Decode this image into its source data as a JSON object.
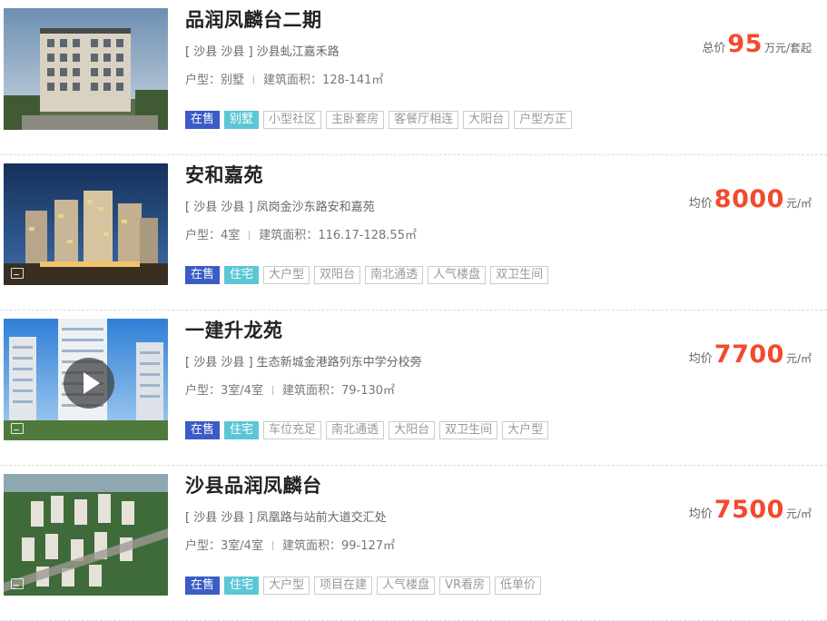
{
  "listings": [
    {
      "name": "品润凤麟台二期",
      "address": "[ 沙县 沙县 ] 沙县虬江嘉禾路",
      "layout_label": "户型：",
      "layout_value": "别墅",
      "area_label": "建筑面积：",
      "area_value": "128-141㎡",
      "status": "在售",
      "property_type": "别墅",
      "tags": [
        "小型社区",
        "主卧套房",
        "客餐厅相连",
        "大阳台",
        "户型方正"
      ],
      "price_prefix": "总价",
      "price_value": "95",
      "price_unit": "万元/套起",
      "media_icon": "none"
    },
    {
      "name": "安和嘉苑",
      "address": "[ 沙县 沙县 ] 凤岗金沙东路安和嘉苑",
      "layout_label": "户型：",
      "layout_value": "4室",
      "area_label": "建筑面积：",
      "area_value": "116.17-128.55㎡",
      "status": "在售",
      "property_type": "住宅",
      "tags": [
        "大户型",
        "双阳台",
        "南北通透",
        "人气楼盘",
        "双卫生间"
      ],
      "price_prefix": "均价",
      "price_value": "8000",
      "price_unit": "元/㎡",
      "media_icon": "picture-icon"
    },
    {
      "name": "一建升龙苑",
      "address": "[ 沙县 沙县 ] 生态新城金港路列东中学分校旁",
      "layout_label": "户型：",
      "layout_value": "3室/4室",
      "area_label": "建筑面积：",
      "area_value": "79-130㎡",
      "status": "在售",
      "property_type": "住宅",
      "tags": [
        "车位充足",
        "南北通透",
        "大阳台",
        "双卫生间",
        "大户型"
      ],
      "price_prefix": "均价",
      "price_value": "7700",
      "price_unit": "元/㎡",
      "media_icon": "play-icon"
    },
    {
      "name": "沙县品润凤麟台",
      "address": "[ 沙县 沙县 ] 凤凰路与站前大道交汇处",
      "layout_label": "户型：",
      "layout_value": "3室/4室",
      "area_label": "建筑面积：",
      "area_value": "99-127㎡",
      "status": "在售",
      "property_type": "住宅",
      "tags": [
        "大户型",
        "项目在建",
        "人气楼盘",
        "VR看房",
        "低单价"
      ],
      "price_prefix": "均价",
      "price_value": "7500",
      "price_unit": "元/㎡",
      "media_icon": "picture-icon"
    }
  ],
  "colors": {
    "status_bg": "#3b5cc7",
    "type_bg": "#5bc6d6",
    "price": "#f24b2c"
  }
}
